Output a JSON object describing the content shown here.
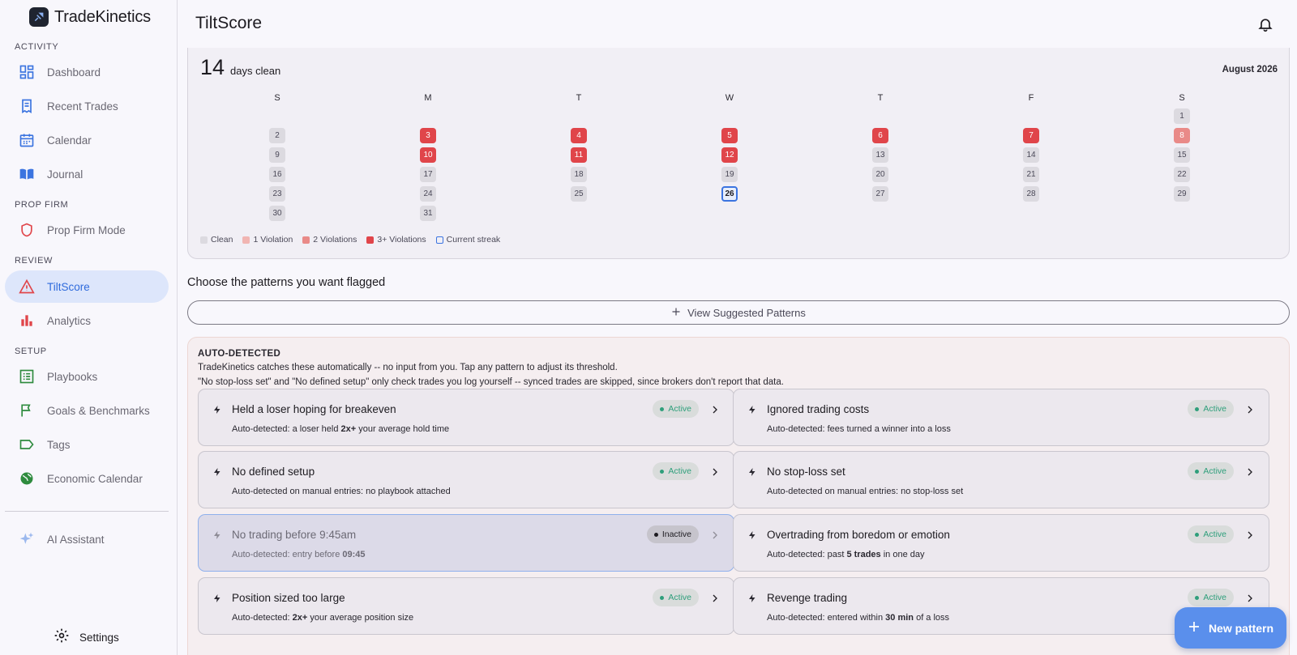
{
  "app": {
    "name": "TradeKinetics"
  },
  "sidebar": {
    "sections": [
      {
        "label": "ACTIVITY"
      },
      {
        "label": "PROP FIRM"
      },
      {
        "label": "REVIEW"
      },
      {
        "label": "SETUP"
      }
    ],
    "items": [
      {
        "label": "Dashboard",
        "icon": "dashboard-icon"
      },
      {
        "label": "Recent Trades",
        "icon": "receipt-icon"
      },
      {
        "label": "Calendar",
        "icon": "calendar-icon"
      },
      {
        "label": "Journal",
        "icon": "book-icon"
      },
      {
        "label": "Prop Firm Mode",
        "icon": "shield-icon"
      },
      {
        "label": "TiltScore",
        "icon": "warning-icon",
        "active": true
      },
      {
        "label": "Analytics",
        "icon": "bar-chart-icon"
      },
      {
        "label": "Playbooks",
        "icon": "list-icon"
      },
      {
        "label": "Goals & Benchmarks",
        "icon": "flag-icon"
      },
      {
        "label": "Tags",
        "icon": "tag-icon"
      },
      {
        "label": "Economic Calendar",
        "icon": "globe-icon"
      },
      {
        "label": "AI Assistant",
        "icon": "sparkle-icon"
      }
    ],
    "settings_label": "Settings"
  },
  "header": {
    "title": "TiltScore"
  },
  "calendar": {
    "streak_number": "14",
    "streak_text": "days clean",
    "month": "August 2026",
    "weekdays": [
      "S",
      "M",
      "T",
      "W",
      "T",
      "F",
      "S"
    ],
    "days": [
      {
        "d": "1",
        "s": "clean"
      },
      {
        "d": "2",
        "s": "clean"
      },
      {
        "d": "3",
        "s": "v3"
      },
      {
        "d": "4",
        "s": "v3"
      },
      {
        "d": "5",
        "s": "v3"
      },
      {
        "d": "6",
        "s": "v3"
      },
      {
        "d": "7",
        "s": "v3"
      },
      {
        "d": "8",
        "s": "v2"
      },
      {
        "d": "9",
        "s": "clean"
      },
      {
        "d": "10",
        "s": "v3"
      },
      {
        "d": "11",
        "s": "v3"
      },
      {
        "d": "12",
        "s": "v3"
      },
      {
        "d": "13",
        "s": "clean"
      },
      {
        "d": "14",
        "s": "clean"
      },
      {
        "d": "15",
        "s": "clean"
      },
      {
        "d": "16",
        "s": "clean"
      },
      {
        "d": "17",
        "s": "clean"
      },
      {
        "d": "18",
        "s": "clean"
      },
      {
        "d": "19",
        "s": "clean"
      },
      {
        "d": "20",
        "s": "clean"
      },
      {
        "d": "21",
        "s": "clean"
      },
      {
        "d": "22",
        "s": "clean"
      },
      {
        "d": "23",
        "s": "clean"
      },
      {
        "d": "24",
        "s": "clean"
      },
      {
        "d": "25",
        "s": "clean"
      },
      {
        "d": "26",
        "s": "current"
      },
      {
        "d": "27",
        "s": "clean"
      },
      {
        "d": "28",
        "s": "clean"
      },
      {
        "d": "29",
        "s": "clean"
      },
      {
        "d": "30",
        "s": "clean"
      },
      {
        "d": "31",
        "s": "clean"
      }
    ],
    "first_weekday": 6,
    "legend": [
      {
        "label": "Clean",
        "color": "#dcdae0"
      },
      {
        "label": "1 Violation",
        "color": "#f1b5b2"
      },
      {
        "label": "2 Violations",
        "color": "#e98a88"
      },
      {
        "label": "3+ Violations",
        "color": "#e0454a"
      },
      {
        "label": "Current streak",
        "color": "#3b74e0"
      }
    ]
  },
  "patterns_section": {
    "title": "Choose the patterns you want flagged",
    "suggest_label": "View Suggested Patterns"
  },
  "auto_detected": {
    "title": "AUTO-DETECTED",
    "desc1": "TradeKinetics catches these automatically -- no input from you. Tap any pattern to adjust its threshold.",
    "desc2": "\"No stop-loss set\" and \"No defined setup\" only check trades you log yourself -- synced trades are skipped, since brokers don't report that data.",
    "patterns": [
      {
        "name": "Held a loser hoping for breakeven",
        "desc_pre": "Auto-detected: a loser held ",
        "desc_bold": "2x+",
        "desc_post": " your average hold time",
        "status": "Active"
      },
      {
        "name": "Ignored trading costs",
        "desc_pre": "Auto-detected: fees turned a winner into a loss",
        "desc_bold": "",
        "desc_post": "",
        "status": "Active"
      },
      {
        "name": "No defined setup",
        "desc_pre": "Auto-detected on manual entries: no playbook attached",
        "desc_bold": "",
        "desc_post": "",
        "status": "Active"
      },
      {
        "name": "No stop-loss set",
        "desc_pre": "Auto-detected on manual entries: no stop-loss set",
        "desc_bold": "",
        "desc_post": "",
        "status": "Active"
      },
      {
        "name": "No trading before 9:45am",
        "desc_pre": "Auto-detected: entry before ",
        "desc_bold": "09:45",
        "desc_post": "",
        "status": "Inactive"
      },
      {
        "name": "Overtrading from boredom or emotion",
        "desc_pre": "Auto-detected: past ",
        "desc_bold": "5 trades",
        "desc_post": " in one day",
        "status": "Active"
      },
      {
        "name": "Position sized too large",
        "desc_pre": "Auto-detected: ",
        "desc_bold": "2x+",
        "desc_post": " your average position size",
        "status": "Active"
      },
      {
        "name": "Revenge trading",
        "desc_pre": "Auto-detected: entered within ",
        "desc_bold": "30 min",
        "desc_post": " of a loss",
        "status": "Active"
      }
    ]
  },
  "fab": {
    "label": "New pattern"
  }
}
